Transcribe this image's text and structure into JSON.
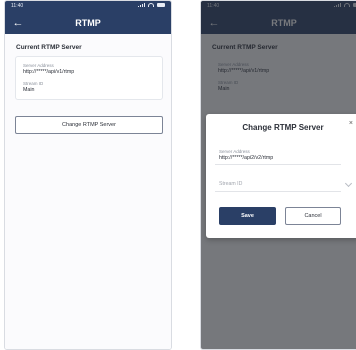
{
  "statusbar": {
    "time": "11:40"
  },
  "app": {
    "title": "RTMP",
    "back_label": "←"
  },
  "current_server": {
    "section_title": "Current RTMP Server",
    "server_address_label": "Server Address",
    "server_address_value": "http://*****/api/v1/rtmp",
    "stream_id_label": "Stream ID",
    "stream_id_value": "Main"
  },
  "actions": {
    "change_server_label": "Change RTMP Server"
  },
  "dialog": {
    "title": "Change RTMP Server",
    "close_label": "×",
    "server_address_label": "Server Address",
    "server_address_value": "http://*****/api2/v2/rtmp",
    "stream_id_placeholder": "Stream ID",
    "save_label": "Save",
    "cancel_label": "Cancel"
  },
  "colors": {
    "primary": "#2a3f66",
    "overlay": "#23262d"
  },
  "icons": {
    "back": "arrow-left-icon",
    "close": "close-icon",
    "dropdown": "chevron-down-icon"
  }
}
